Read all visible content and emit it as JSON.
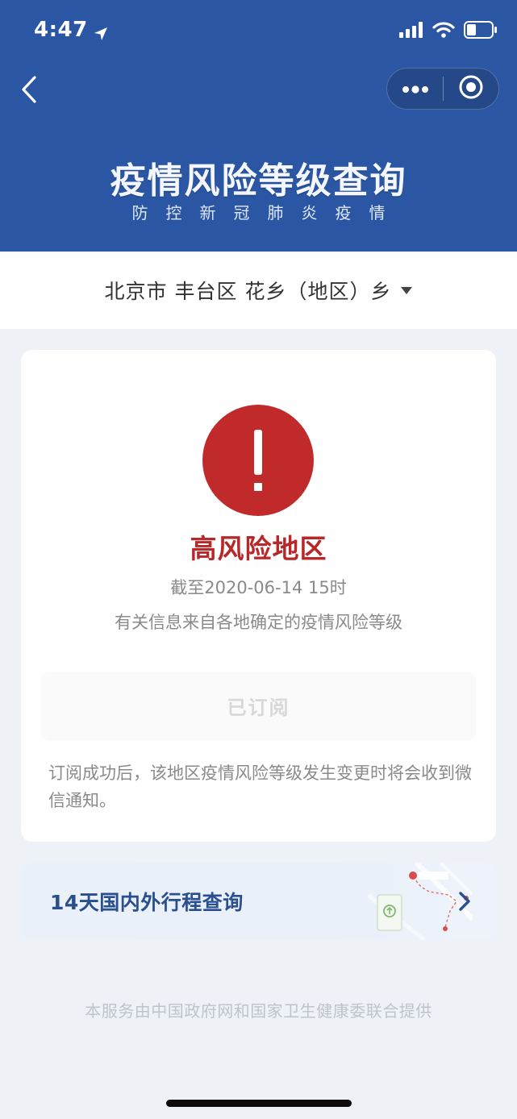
{
  "status_bar": {
    "time": "4:47",
    "icons": [
      "location-arrow-icon",
      "signal-icon",
      "wifi-icon",
      "battery-icon"
    ]
  },
  "nav": {
    "back_icon": "chevron-left-icon",
    "capsule_icons": [
      "more-dots-icon",
      "close-target-icon"
    ]
  },
  "header": {
    "title": "疫情风险等级查询",
    "subtitle": "防控新冠肺炎疫情"
  },
  "location": {
    "text": "北京市 丰台区 花乡（地区）乡",
    "dropdown_icon": "caret-down-icon"
  },
  "risk_card": {
    "icon": "exclamation-icon",
    "level": "高风险地区",
    "as_of": "截至2020-06-14 15时",
    "source_note": "有关信息来自各地确定的疫情风险等级",
    "subscribe_button": "已订阅",
    "subscribe_note": "订阅成功后，该地区疫情风险等级发生变更时将会收到微信通知。"
  },
  "itinerary": {
    "label": "14天国内外行程查询",
    "icon": "chevron-right-icon"
  },
  "footer": {
    "note": "本服务由中国政府网和国家卫生健康委联合提供"
  },
  "colors": {
    "header_bg": "#2b56a3",
    "risk_red": "#c12a2a",
    "risk_text": "#b82828",
    "itinerary_text": "#2a4f8f",
    "page_bg": "#eef1f5"
  }
}
